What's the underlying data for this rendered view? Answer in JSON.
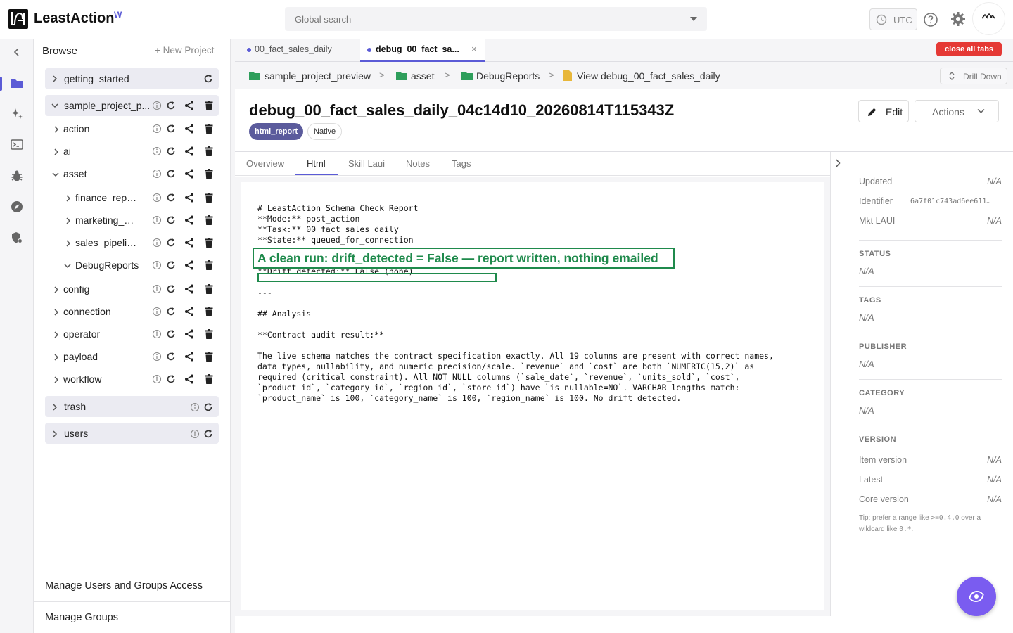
{
  "app": {
    "title": "LeastAction",
    "sup": "W"
  },
  "search": {
    "placeholder": "Global search"
  },
  "topbar": {
    "utc": "UTC"
  },
  "browse": {
    "title": "Browse",
    "new_project": "+ New Project",
    "rows": [
      {
        "label": "getting_started"
      },
      {
        "label": "sample_project_p..."
      },
      {
        "label": "action"
      },
      {
        "label": "ai"
      },
      {
        "label": "asset"
      },
      {
        "label": "finance_repo..."
      },
      {
        "label": "marketing_a..."
      },
      {
        "label": "sales_pipelin..."
      },
      {
        "label": "DebugReports"
      },
      {
        "label": "config"
      },
      {
        "label": "connection"
      },
      {
        "label": "operator"
      },
      {
        "label": "payload"
      },
      {
        "label": "workflow"
      },
      {
        "label": "trash"
      },
      {
        "label": "users"
      }
    ],
    "manage_access": "Manage Users and Groups Access",
    "manage_groups": "Manage Groups"
  },
  "file_tabs": [
    {
      "label": "00_fact_sales_daily"
    },
    {
      "label": "debug_00_fact_sa...",
      "close": "×"
    }
  ],
  "close_all": "close all tabs",
  "breadcrumb": {
    "items": [
      "sample_project_preview",
      "asset",
      "DebugReports",
      "View debug_00_fact_sales_daily"
    ],
    "sep": ">"
  },
  "drill_down": "Drill Down",
  "page": {
    "title": "debug_00_fact_sales_daily_04c14d10_20260814T115343Z",
    "badge_type": "html_report",
    "badge_native": "Native",
    "edit": "Edit",
    "actions": "Actions"
  },
  "content_tabs": [
    "Overview",
    "Html",
    "Skill Laui",
    "Notes",
    "Tags"
  ],
  "report": {
    "header_lines": "# LeastAction Schema Check Report\n**Mode:** post_action\n**Task:** 00_fact_sales_daily\n**State:** queued_for_connection",
    "drift_line": "**Drift detected:** False (none)",
    "annotation": "A clean run: drift_detected = False — report written, nothing emailed",
    "body": "---\n\n## Analysis\n\n**Contract audit result:**\n\nThe live schema matches the contract specification exactly. All 19 columns are present with correct names,\ndata types, nullability, and numeric precision/scale. `revenue` and `cost` are both `NUMERIC(15,2)` as\nrequired (critical constraint). All NOT NULL columns (`sale_date`, `revenue`, `units_sold`, `cost`,\n`product_id`, `category_id`, `region_id`, `store_id`) have `is_nullable=NO`. VARCHAR lengths match:\n`product_name` is 100, `category_name` is 100, `region_name` is 100. No drift detected."
  },
  "sidebar": {
    "kv_top": [
      {
        "k": "Updated",
        "v": "N/A"
      },
      {
        "k": "Identifier",
        "v": "6a7f01c743ad6ee61192..."
      },
      {
        "k": "Mkt LAUI",
        "v": "N/A"
      }
    ],
    "sections": [
      {
        "h": "STATUS",
        "v": "N/A"
      },
      {
        "h": "TAGS",
        "v": "N/A"
      },
      {
        "h": "PUBLISHER",
        "v": "N/A"
      },
      {
        "h": "CATEGORY",
        "v": "N/A"
      }
    ],
    "version_h": "VERSION",
    "version_kv": [
      {
        "k": "Item version",
        "v": "N/A"
      },
      {
        "k": "Latest",
        "v": "N/A"
      },
      {
        "k": "Core version",
        "v": "N/A"
      }
    ],
    "tip_a": "Tip: prefer a range like ",
    "tip_code1": ">=0.4.0",
    "tip_b": " over a wildcard like ",
    "tip_code2": "0.*",
    "tip_c": "."
  },
  "colors": {
    "accent": "#5b5bd6",
    "danger": "#e53935",
    "annotation": "#1f8a4c",
    "fab": "#7a5cf0"
  }
}
